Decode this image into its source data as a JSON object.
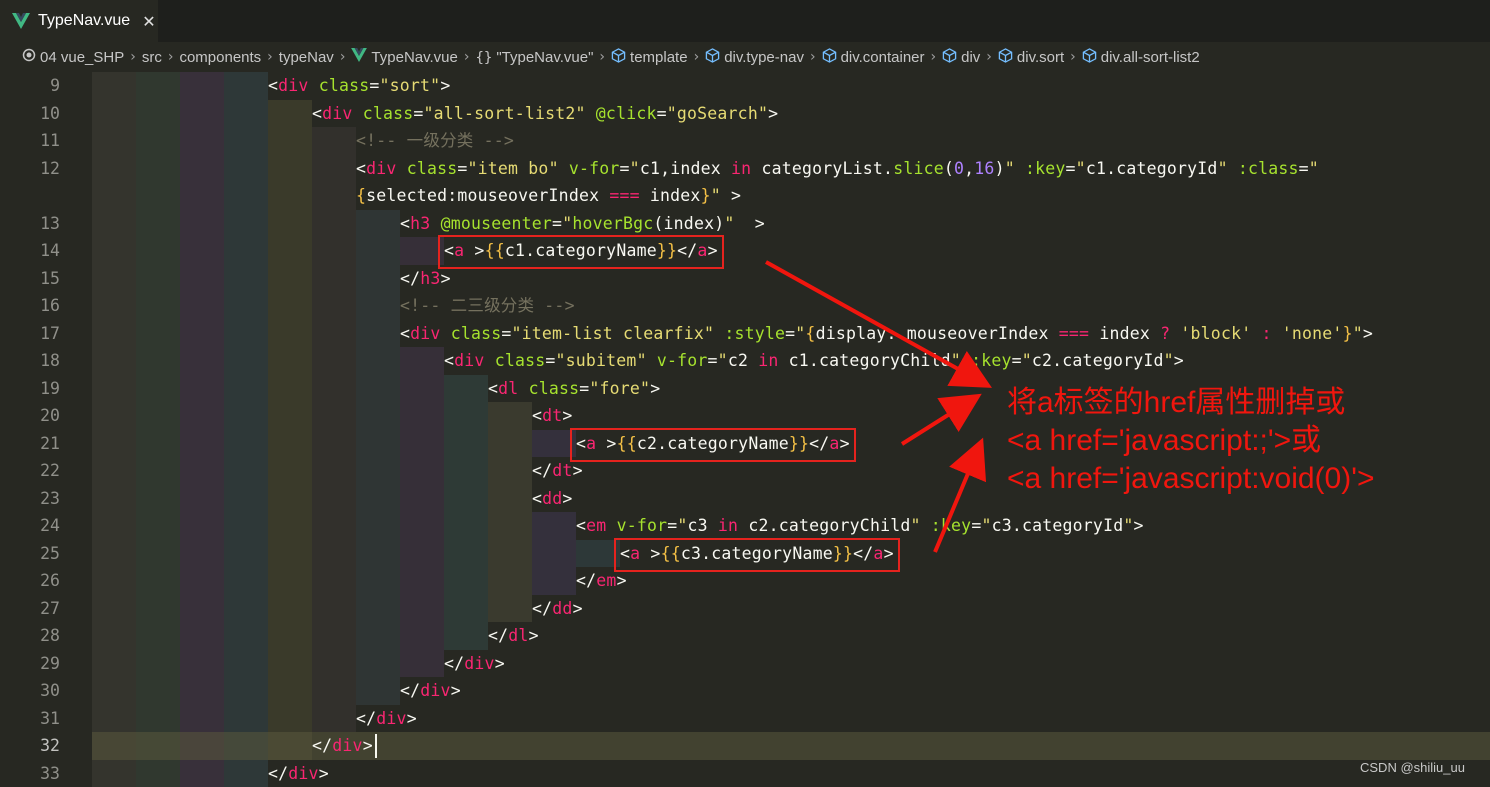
{
  "tab": {
    "filename": "TypeNav.vue",
    "close": "✕"
  },
  "breadcrumb": {
    "items": [
      {
        "icon": "circle-icon",
        "label": "04 vue_SHP"
      },
      {
        "icon": "",
        "label": "src"
      },
      {
        "icon": "",
        "label": "components"
      },
      {
        "icon": "",
        "label": "typeNav"
      },
      {
        "icon": "vue-icon",
        "label": "TypeNav.vue"
      },
      {
        "icon": "braces-icon",
        "label": "\"TypeNav.vue\""
      },
      {
        "icon": "cube-icon",
        "label": "template"
      },
      {
        "icon": "cube-icon",
        "label": "div.type-nav"
      },
      {
        "icon": "cube-icon",
        "label": "div.container"
      },
      {
        "icon": "cube-icon",
        "label": "div"
      },
      {
        "icon": "cube-icon",
        "label": "div.sort"
      },
      {
        "icon": "cube-icon",
        "label": "div.all-sort-list2"
      }
    ]
  },
  "editor": {
    "active_line": "32",
    "lines": [
      {
        "num": "9",
        "indent": 4,
        "tokens": [
          [
            "p",
            "<"
          ],
          [
            "tag",
            "div"
          ],
          [
            "p",
            " "
          ],
          [
            "attr",
            "class"
          ],
          [
            "p",
            "="
          ],
          [
            "str",
            "\"sort\""
          ],
          [
            "p",
            ">"
          ]
        ]
      },
      {
        "num": "10",
        "indent": 5,
        "tokens": [
          [
            "p",
            "<"
          ],
          [
            "tag",
            "div"
          ],
          [
            "p",
            " "
          ],
          [
            "attr",
            "class"
          ],
          [
            "p",
            "="
          ],
          [
            "str",
            "\"all-sort-list2\""
          ],
          [
            "p",
            " "
          ],
          [
            "attr",
            "@click"
          ],
          [
            "p",
            "="
          ],
          [
            "str",
            "\"goSearch\""
          ],
          [
            "p",
            ">"
          ]
        ]
      },
      {
        "num": "11",
        "indent": 6,
        "tokens": [
          [
            "cmt",
            "<!-- 一级分类 -->"
          ]
        ]
      },
      {
        "num": "12",
        "indent": 6,
        "tokens": [
          [
            "p",
            "<"
          ],
          [
            "tag",
            "div"
          ],
          [
            "p",
            " "
          ],
          [
            "attr",
            "class"
          ],
          [
            "p",
            "="
          ],
          [
            "str",
            "\"item bo\""
          ],
          [
            "p",
            " "
          ],
          [
            "attr",
            "v-for"
          ],
          [
            "p",
            "="
          ],
          [
            "str",
            "\""
          ],
          [
            "p",
            "c1,index "
          ],
          [
            "kw",
            "in"
          ],
          [
            "p",
            " categoryList."
          ],
          [
            "fn",
            "slice"
          ],
          [
            "p",
            "("
          ],
          [
            "num",
            "0"
          ],
          [
            "p",
            ","
          ],
          [
            "num",
            "16"
          ],
          [
            "p",
            ")"
          ],
          [
            "str",
            "\""
          ],
          [
            "p",
            " "
          ],
          [
            "attr",
            ":key"
          ],
          [
            "p",
            "="
          ],
          [
            "str",
            "\""
          ],
          [
            "p",
            "c1.categoryId"
          ],
          [
            "str",
            "\""
          ],
          [
            "p",
            " "
          ],
          [
            "attr",
            ":class"
          ],
          [
            "p",
            "="
          ],
          [
            "str",
            "\""
          ]
        ]
      },
      {
        "num": "",
        "indent": 6,
        "tokens": [
          [
            "br",
            "{"
          ],
          [
            "p",
            "selected:mouseoverIndex "
          ],
          [
            "op",
            "==="
          ],
          [
            "p",
            " index"
          ],
          [
            "br",
            "}"
          ],
          [
            "str",
            "\""
          ],
          [
            "p",
            " >"
          ]
        ]
      },
      {
        "num": "13",
        "indent": 7,
        "tokens": [
          [
            "p",
            "<"
          ],
          [
            "tag",
            "h3"
          ],
          [
            "p",
            " "
          ],
          [
            "attr",
            "@mouseenter"
          ],
          [
            "p",
            "="
          ],
          [
            "str",
            "\""
          ],
          [
            "fn",
            "hoverBgc"
          ],
          [
            "p",
            "(index)"
          ],
          [
            "str",
            "\""
          ],
          [
            "p",
            "  >"
          ]
        ]
      },
      {
        "num": "14",
        "indent": 8,
        "tokens": [
          [
            "p",
            "<"
          ],
          [
            "tag",
            "a"
          ],
          [
            "p",
            " >"
          ],
          [
            "br",
            "{{"
          ],
          [
            "p",
            "c1.categoryName"
          ],
          [
            "br",
            "}}"
          ],
          [
            "p",
            "</"
          ],
          [
            "tag",
            "a"
          ],
          [
            "p",
            ">"
          ]
        ]
      },
      {
        "num": "15",
        "indent": 7,
        "tokens": [
          [
            "p",
            "</"
          ],
          [
            "tag",
            "h3"
          ],
          [
            "p",
            ">"
          ]
        ]
      },
      {
        "num": "16",
        "indent": 7,
        "tokens": [
          [
            "cmt",
            "<!-- 二三级分类 -->"
          ]
        ]
      },
      {
        "num": "17",
        "indent": 7,
        "tokens": [
          [
            "p",
            "<"
          ],
          [
            "tag",
            "div"
          ],
          [
            "p",
            " "
          ],
          [
            "attr",
            "class"
          ],
          [
            "p",
            "="
          ],
          [
            "str",
            "\"item-list clearfix\""
          ],
          [
            "p",
            " "
          ],
          [
            "attr",
            ":style"
          ],
          [
            "p",
            "="
          ],
          [
            "str",
            "\""
          ],
          [
            "br",
            "{"
          ],
          [
            "p",
            "display: mouseoverIndex "
          ],
          [
            "op",
            "==="
          ],
          [
            "p",
            " index "
          ],
          [
            "op",
            "?"
          ],
          [
            "p",
            " "
          ],
          [
            "str",
            "'block'"
          ],
          [
            "p",
            " "
          ],
          [
            "op",
            ":"
          ],
          [
            "p",
            " "
          ],
          [
            "str",
            "'none'"
          ],
          [
            "br",
            "}"
          ],
          [
            "str",
            "\""
          ],
          [
            "p",
            ">"
          ]
        ]
      },
      {
        "num": "18",
        "indent": 8,
        "tokens": [
          [
            "p",
            "<"
          ],
          [
            "tag",
            "div"
          ],
          [
            "p",
            " "
          ],
          [
            "attr",
            "class"
          ],
          [
            "p",
            "="
          ],
          [
            "str",
            "\"subitem\""
          ],
          [
            "p",
            " "
          ],
          [
            "attr",
            "v-for"
          ],
          [
            "p",
            "="
          ],
          [
            "str",
            "\""
          ],
          [
            "p",
            "c2 "
          ],
          [
            "kw",
            "in"
          ],
          [
            "p",
            " c1.categoryChild"
          ],
          [
            "str",
            "\""
          ],
          [
            "p",
            " "
          ],
          [
            "attr",
            ":key"
          ],
          [
            "p",
            "="
          ],
          [
            "str",
            "\""
          ],
          [
            "p",
            "c2.categoryId"
          ],
          [
            "str",
            "\""
          ],
          [
            "p",
            ">"
          ]
        ]
      },
      {
        "num": "19",
        "indent": 9,
        "tokens": [
          [
            "p",
            "<"
          ],
          [
            "tag",
            "dl"
          ],
          [
            "p",
            " "
          ],
          [
            "attr",
            "class"
          ],
          [
            "p",
            "="
          ],
          [
            "str",
            "\"fore\""
          ],
          [
            "p",
            ">"
          ]
        ]
      },
      {
        "num": "20",
        "indent": 10,
        "tokens": [
          [
            "p",
            "<"
          ],
          [
            "tag",
            "dt"
          ],
          [
            "p",
            ">"
          ]
        ]
      },
      {
        "num": "21",
        "indent": 11,
        "tokens": [
          [
            "p",
            "<"
          ],
          [
            "tag",
            "a"
          ],
          [
            "p",
            " >"
          ],
          [
            "br",
            "{{"
          ],
          [
            "p",
            "c2.categoryName"
          ],
          [
            "br",
            "}}"
          ],
          [
            "p",
            "</"
          ],
          [
            "tag",
            "a"
          ],
          [
            "p",
            ">"
          ]
        ]
      },
      {
        "num": "22",
        "indent": 10,
        "tokens": [
          [
            "p",
            "</"
          ],
          [
            "tag",
            "dt"
          ],
          [
            "p",
            ">"
          ]
        ]
      },
      {
        "num": "23",
        "indent": 10,
        "tokens": [
          [
            "p",
            "<"
          ],
          [
            "tag",
            "dd"
          ],
          [
            "p",
            ">"
          ]
        ]
      },
      {
        "num": "24",
        "indent": 11,
        "tokens": [
          [
            "p",
            "<"
          ],
          [
            "tag",
            "em"
          ],
          [
            "p",
            " "
          ],
          [
            "attr",
            "v-for"
          ],
          [
            "p",
            "="
          ],
          [
            "str",
            "\""
          ],
          [
            "p",
            "c3 "
          ],
          [
            "kw",
            "in"
          ],
          [
            "p",
            " c2.categoryChild"
          ],
          [
            "str",
            "\""
          ],
          [
            "p",
            " "
          ],
          [
            "attr",
            ":key"
          ],
          [
            "p",
            "="
          ],
          [
            "str",
            "\""
          ],
          [
            "p",
            "c3.categoryId"
          ],
          [
            "str",
            "\""
          ],
          [
            "p",
            ">"
          ]
        ]
      },
      {
        "num": "25",
        "indent": 12,
        "tokens": [
          [
            "p",
            "<"
          ],
          [
            "tag",
            "a"
          ],
          [
            "p",
            " >"
          ],
          [
            "br",
            "{{"
          ],
          [
            "p",
            "c3.categoryName"
          ],
          [
            "br",
            "}}"
          ],
          [
            "p",
            "</"
          ],
          [
            "tag",
            "a"
          ],
          [
            "p",
            ">"
          ]
        ]
      },
      {
        "num": "26",
        "indent": 11,
        "tokens": [
          [
            "p",
            "</"
          ],
          [
            "tag",
            "em"
          ],
          [
            "p",
            ">"
          ]
        ]
      },
      {
        "num": "27",
        "indent": 10,
        "tokens": [
          [
            "p",
            "</"
          ],
          [
            "tag",
            "dd"
          ],
          [
            "p",
            ">"
          ]
        ]
      },
      {
        "num": "28",
        "indent": 9,
        "tokens": [
          [
            "p",
            "</"
          ],
          [
            "tag",
            "dl"
          ],
          [
            "p",
            ">"
          ]
        ]
      },
      {
        "num": "29",
        "indent": 8,
        "tokens": [
          [
            "p",
            "</"
          ],
          [
            "tag",
            "div"
          ],
          [
            "p",
            ">"
          ]
        ]
      },
      {
        "num": "30",
        "indent": 7,
        "tokens": [
          [
            "p",
            "</"
          ],
          [
            "tag",
            "div"
          ],
          [
            "p",
            ">"
          ]
        ]
      },
      {
        "num": "31",
        "indent": 6,
        "tokens": [
          [
            "p",
            "</"
          ],
          [
            "tag",
            "div"
          ],
          [
            "p",
            ">"
          ]
        ]
      },
      {
        "num": "32",
        "indent": 5,
        "tokens": [
          [
            "p",
            "</"
          ],
          [
            "tag",
            "div"
          ],
          [
            "p",
            ">"
          ]
        ]
      },
      {
        "num": "33",
        "indent": 4,
        "tokens": [
          [
            "p",
            "</"
          ],
          [
            "tag",
            "div"
          ],
          [
            "p",
            ">"
          ]
        ]
      }
    ]
  },
  "annotation": {
    "lines": [
      "将a标签的href属性删掉或",
      "<a href='javascript:;'>或",
      "<a href='javascript:void(0)'>"
    ]
  },
  "watermark": "CSDN @shiliu_uu",
  "colors": {
    "background": "#272822",
    "annotation_red": "#f0160e",
    "box_red": "#e5231e"
  }
}
